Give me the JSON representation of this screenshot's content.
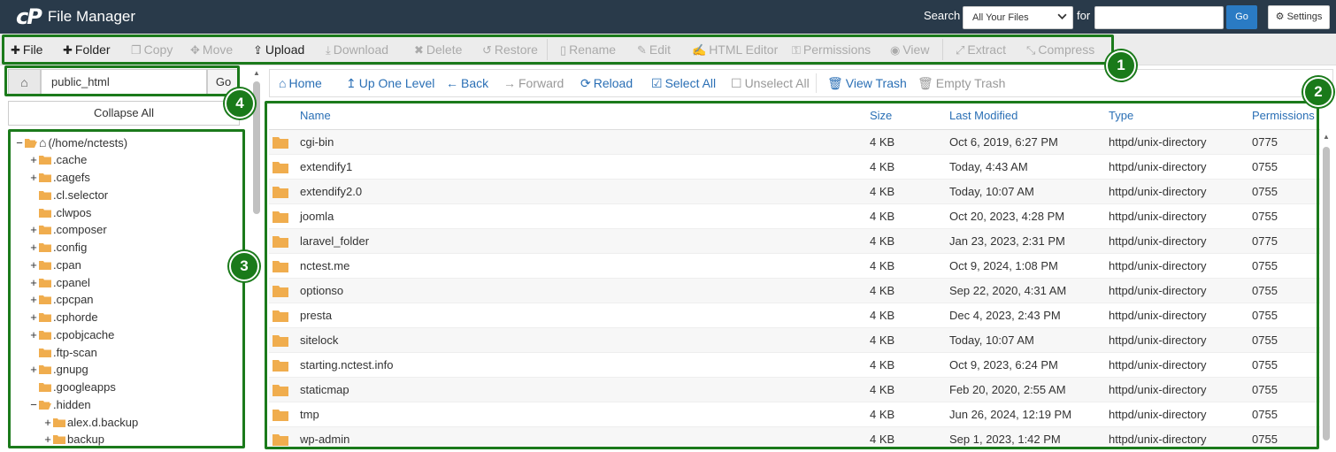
{
  "header": {
    "logo": "cP",
    "title": "File Manager",
    "search_label": "Search",
    "search_scope": "All Your Files",
    "for_label": "for",
    "search_value": "",
    "go_label": "Go",
    "settings_label": "Settings",
    "background": "#293a4a",
    "accent": "#2a7bc4"
  },
  "toolbar": {
    "items": [
      {
        "label": "File",
        "icon": "plus-icon",
        "enabled": true
      },
      {
        "label": "Folder",
        "icon": "plus-icon",
        "enabled": true
      },
      {
        "label": "Copy",
        "icon": "copy-icon",
        "enabled": false
      },
      {
        "label": "Move",
        "icon": "move-icon",
        "enabled": false
      },
      {
        "label": "Upload",
        "icon": "upload-icon",
        "enabled": true
      },
      {
        "label": "Download",
        "icon": "download-icon",
        "enabled": false
      },
      {
        "label": "Delete",
        "icon": "times-icon",
        "enabled": false
      },
      {
        "label": "Restore",
        "icon": "undo-icon",
        "enabled": false
      },
      {
        "label": "Rename",
        "icon": "file-icon",
        "enabled": false
      },
      {
        "label": "Edit",
        "icon": "pencil-icon",
        "enabled": false
      },
      {
        "label": "HTML Editor",
        "icon": "edit-icon",
        "enabled": false
      },
      {
        "label": "Permissions",
        "icon": "key-icon",
        "enabled": false
      },
      {
        "label": "View",
        "icon": "eye-icon",
        "enabled": false
      },
      {
        "label": "Extract",
        "icon": "expand-icon",
        "enabled": false
      },
      {
        "label": "Compress",
        "icon": "compress-icon",
        "enabled": false
      }
    ]
  },
  "path": {
    "value": "public_html",
    "go_label": "Go",
    "collapse_label": "Collapse All"
  },
  "tree": {
    "items": [
      {
        "label": "(/home/nctests)",
        "toggle": "−",
        "open": true,
        "home": true,
        "indent": 0
      },
      {
        "label": ".cache",
        "toggle": "+",
        "indent": 1
      },
      {
        "label": ".cagefs",
        "toggle": "+",
        "indent": 1
      },
      {
        "label": ".cl.selector",
        "toggle": "",
        "indent": 1
      },
      {
        "label": ".clwpos",
        "toggle": "",
        "indent": 1
      },
      {
        "label": ".composer",
        "toggle": "+",
        "indent": 1
      },
      {
        "label": ".config",
        "toggle": "+",
        "indent": 1
      },
      {
        "label": ".cpan",
        "toggle": "+",
        "indent": 1
      },
      {
        "label": ".cpanel",
        "toggle": "+",
        "indent": 1
      },
      {
        "label": ".cpcpan",
        "toggle": "+",
        "indent": 1
      },
      {
        "label": ".cphorde",
        "toggle": "+",
        "indent": 1
      },
      {
        "label": ".cpobjcache",
        "toggle": "+",
        "indent": 1
      },
      {
        "label": ".ftp-scan",
        "toggle": "",
        "indent": 1
      },
      {
        "label": ".gnupg",
        "toggle": "+",
        "indent": 1
      },
      {
        "label": ".googleapps",
        "toggle": "",
        "indent": 1
      },
      {
        "label": ".hidden",
        "toggle": "−",
        "open": true,
        "indent": 1
      },
      {
        "label": "alex.d.backup",
        "toggle": "+",
        "indent": 2
      },
      {
        "label": "backup",
        "toggle": "+",
        "indent": 2
      }
    ]
  },
  "nav": {
    "items": [
      {
        "label": "Home",
        "icon": "home-icon",
        "enabled": true
      },
      {
        "label": "Up One Level",
        "icon": "level-up-icon",
        "enabled": true
      },
      {
        "label": "Back",
        "icon": "arrow-left-icon",
        "enabled": true
      },
      {
        "label": "Forward",
        "icon": "arrow-right-icon",
        "enabled": false
      },
      {
        "label": "Reload",
        "icon": "refresh-icon",
        "enabled": true
      },
      {
        "label": "Select All",
        "icon": "check-square-icon",
        "enabled": true
      },
      {
        "label": "Unselect All",
        "icon": "square-icon",
        "enabled": false
      },
      {
        "label": "View Trash",
        "icon": "trash-icon",
        "enabled": true
      },
      {
        "label": "Empty Trash",
        "icon": "trash-icon",
        "enabled": false
      }
    ]
  },
  "table": {
    "columns": [
      "Name",
      "Size",
      "Last Modified",
      "Type",
      "Permissions"
    ],
    "rows": [
      [
        "cgi-bin",
        "4 KB",
        "Oct 6, 2019, 6:27 PM",
        "httpd/unix-directory",
        "0775"
      ],
      [
        "extendify1",
        "4 KB",
        "Today, 4:43 AM",
        "httpd/unix-directory",
        "0755"
      ],
      [
        "extendify2.0",
        "4 KB",
        "Today, 10:07 AM",
        "httpd/unix-directory",
        "0755"
      ],
      [
        "joomla",
        "4 KB",
        "Oct 20, 2023, 4:28 PM",
        "httpd/unix-directory",
        "0755"
      ],
      [
        "laravel_folder",
        "4 KB",
        "Jan 23, 2023, 2:31 PM",
        "httpd/unix-directory",
        "0775"
      ],
      [
        "nctest.me",
        "4 KB",
        "Oct 9, 2024, 1:08 PM",
        "httpd/unix-directory",
        "0755"
      ],
      [
        "optionso",
        "4 KB",
        "Sep 22, 2020, 4:31 AM",
        "httpd/unix-directory",
        "0755"
      ],
      [
        "presta",
        "4 KB",
        "Dec 4, 2023, 2:43 PM",
        "httpd/unix-directory",
        "0755"
      ],
      [
        "sitelock",
        "4 KB",
        "Today, 10:07 AM",
        "httpd/unix-directory",
        "0755"
      ],
      [
        "starting.nctest.info",
        "4 KB",
        "Oct 9, 2023, 6:24 PM",
        "httpd/unix-directory",
        "0755"
      ],
      [
        "staticmap",
        "4 KB",
        "Feb 20, 2020, 2:55 AM",
        "httpd/unix-directory",
        "0755"
      ],
      [
        "tmp",
        "4 KB",
        "Jun 26, 2024, 12:19 PM",
        "httpd/unix-directory",
        "0755"
      ],
      [
        "wp-admin",
        "4 KB",
        "Sep 1, 2023, 1:42 PM",
        "httpd/unix-directory",
        "0755"
      ]
    ]
  },
  "callouts": {
    "items": [
      {
        "label": "1"
      },
      {
        "label": "2"
      },
      {
        "label": "3"
      },
      {
        "label": "4"
      }
    ],
    "color": "#1a7a1a"
  },
  "colors": {
    "folder": "#f0ad4e",
    "link": "#2a6fb5"
  }
}
